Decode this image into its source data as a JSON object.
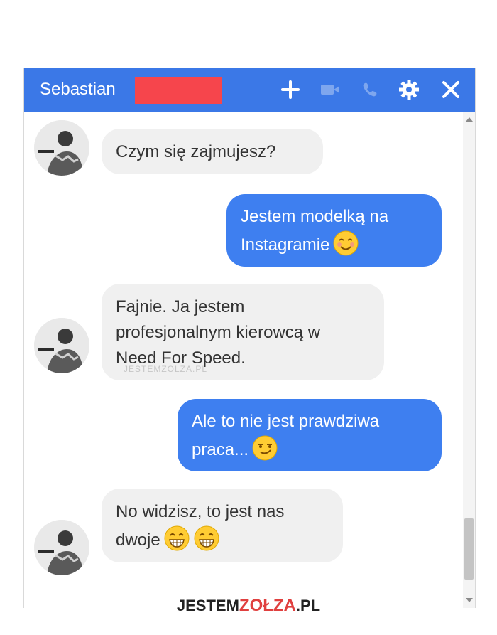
{
  "theme": {
    "accent": "#3b78e7",
    "incoming_bubble": "#f0f0f0",
    "outgoing_bubble": "#3e7ff0"
  },
  "header": {
    "contact_name": "Sebastian",
    "icons": [
      "plus-icon",
      "video-icon",
      "phone-icon",
      "gear-icon",
      "close-icon"
    ]
  },
  "messages": [
    {
      "from": "contact",
      "text": "Czym się zajmujesz?"
    },
    {
      "from": "me",
      "line1": "Jestem modelką na",
      "line2": "Instagramie",
      "emoji": "smiling-face-emoji"
    },
    {
      "from": "contact",
      "line1": "Fajnie. Ja jestem",
      "line2": "profesjonalnym kierowcą w",
      "line3": "Need For Speed."
    },
    {
      "from": "me",
      "line1": "Ale to nie jest prawdziwa",
      "line2": "praca...",
      "emoji": "smirking-face-emoji"
    },
    {
      "from": "contact",
      "line1": "No widzisz, to jest nas",
      "line2": "dwoje",
      "emoji": "grinning-face-emoji"
    }
  ],
  "watermark": "JESTEMZOLZA.PL",
  "footer": {
    "logo_part1": "JESTEM",
    "logo_part2": "ZOŁZA",
    "logo_part3": ".PL"
  }
}
